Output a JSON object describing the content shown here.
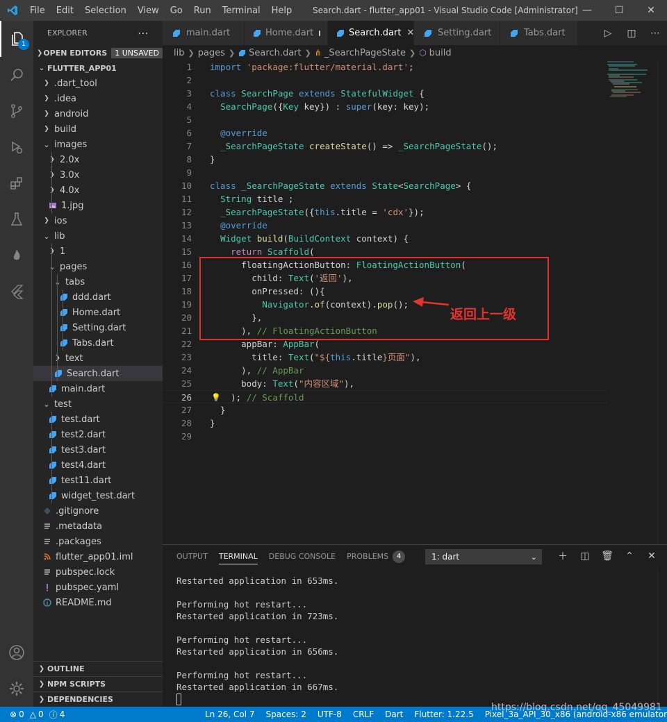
{
  "titlebar": {
    "menu": [
      "File",
      "Edit",
      "Selection",
      "View",
      "Go",
      "Run",
      "Terminal",
      "Help"
    ],
    "window_title": "Search.dart - flutter_app01 - Visual Studio Code [Administrator]"
  },
  "activity": {
    "explorer_badge": "1"
  },
  "sidebar": {
    "title": "EXPLORER",
    "open_editors": "OPEN EDITORS",
    "unsaved": "1 UNSAVED",
    "project": "FLUTTER_APP01",
    "tree": [
      {
        "label": ".dart_tool",
        "kind": "folder",
        "open": false,
        "depth": 1
      },
      {
        "label": ".idea",
        "kind": "folder",
        "open": false,
        "depth": 1
      },
      {
        "label": "android",
        "kind": "folder",
        "open": false,
        "depth": 1
      },
      {
        "label": "build",
        "kind": "folder",
        "open": false,
        "depth": 1
      },
      {
        "label": "images",
        "kind": "folder",
        "open": true,
        "depth": 1
      },
      {
        "label": "2.0x",
        "kind": "folder",
        "open": false,
        "depth": 2
      },
      {
        "label": "3.0x",
        "kind": "folder",
        "open": false,
        "depth": 2
      },
      {
        "label": "4.0x",
        "kind": "folder",
        "open": false,
        "depth": 2
      },
      {
        "label": "1.jpg",
        "kind": "image",
        "depth": 2
      },
      {
        "label": "ios",
        "kind": "folder",
        "open": false,
        "depth": 1
      },
      {
        "label": "lib",
        "kind": "folder",
        "open": true,
        "depth": 1
      },
      {
        "label": "1",
        "kind": "folder",
        "open": false,
        "depth": 2
      },
      {
        "label": "pages",
        "kind": "folder",
        "open": true,
        "depth": 2
      },
      {
        "label": "tabs",
        "kind": "folder",
        "open": true,
        "depth": 3
      },
      {
        "label": "ddd.dart",
        "kind": "dart",
        "depth": 4
      },
      {
        "label": "Home.dart",
        "kind": "dart",
        "depth": 4
      },
      {
        "label": "Setting.dart",
        "kind": "dart",
        "depth": 4
      },
      {
        "label": "Tabs.dart",
        "kind": "dart",
        "depth": 4
      },
      {
        "label": "text",
        "kind": "folder",
        "open": false,
        "depth": 3
      },
      {
        "label": "Search.dart",
        "kind": "dart",
        "depth": 3,
        "selected": true
      },
      {
        "label": "main.dart",
        "kind": "dart",
        "depth": 2
      },
      {
        "label": "test",
        "kind": "folder",
        "open": true,
        "depth": 1
      },
      {
        "label": "test.dart",
        "kind": "dart",
        "depth": 2
      },
      {
        "label": "test2.dart",
        "kind": "dart",
        "depth": 2
      },
      {
        "label": "test3.dart",
        "kind": "dart",
        "depth": 2
      },
      {
        "label": "test4.dart",
        "kind": "dart",
        "depth": 2
      },
      {
        "label": "test11.dart",
        "kind": "dart",
        "depth": 2
      },
      {
        "label": "widget_test.dart",
        "kind": "dart",
        "depth": 2
      },
      {
        "label": ".gitignore",
        "kind": "git",
        "depth": 1
      },
      {
        "label": ".metadata",
        "kind": "lines",
        "depth": 1
      },
      {
        "label": ".packages",
        "kind": "lines",
        "depth": 1
      },
      {
        "label": "flutter_app01.iml",
        "kind": "rss",
        "depth": 1
      },
      {
        "label": "pubspec.lock",
        "kind": "lines",
        "depth": 1
      },
      {
        "label": "pubspec.yaml",
        "kind": "yaml",
        "depth": 1
      },
      {
        "label": "README.md",
        "kind": "info",
        "depth": 1
      }
    ],
    "bottom_sections": [
      "OUTLINE",
      "NPM SCRIPTS",
      "DEPENDENCIES"
    ]
  },
  "tabs": [
    {
      "label": "main.dart",
      "state": "normal"
    },
    {
      "label": "Home.dart",
      "state": "dirty"
    },
    {
      "label": "Search.dart",
      "state": "active"
    },
    {
      "label": "Setting.dart",
      "state": "normal"
    },
    {
      "label": "Tabs.dart",
      "state": "normal"
    }
  ],
  "breadcrumb": [
    "lib",
    "pages",
    "Search.dart",
    "_SearchPageState",
    "build"
  ],
  "code": [
    {
      "n": "1",
      "t": [
        [
          "kw",
          "import"
        ],
        [
          "pl",
          " "
        ],
        [
          "str",
          "'package:flutter/material.dart'"
        ],
        [
          "pl",
          ";"
        ]
      ]
    },
    {
      "n": "2",
      "t": []
    },
    {
      "n": "3",
      "t": [
        [
          "kw",
          "class"
        ],
        [
          "pl",
          " "
        ],
        [
          "cls",
          "SearchPage"
        ],
        [
          "pl",
          " "
        ],
        [
          "kw",
          "extends"
        ],
        [
          "pl",
          " "
        ],
        [
          "cls",
          "StatefulWidget"
        ],
        [
          "pl",
          " {"
        ]
      ]
    },
    {
      "n": "4",
      "t": [
        [
          "pl",
          "  "
        ],
        [
          "cls",
          "SearchPage"
        ],
        [
          "pl",
          "({"
        ],
        [
          "cls",
          "Key"
        ],
        [
          "pl",
          " key}) : "
        ],
        [
          "kw",
          "super"
        ],
        [
          "pl",
          "(key: key);"
        ]
      ]
    },
    {
      "n": "5",
      "t": []
    },
    {
      "n": "6",
      "t": [
        [
          "pl",
          "  "
        ],
        [
          "kw",
          "@override"
        ]
      ]
    },
    {
      "n": "7",
      "t": [
        [
          "pl",
          "  "
        ],
        [
          "cls",
          "_SearchPageState"
        ],
        [
          "pl",
          " "
        ],
        [
          "fn",
          "createState"
        ],
        [
          "pl",
          "() => "
        ],
        [
          "cls",
          "_SearchPageState"
        ],
        [
          "pl",
          "();"
        ]
      ]
    },
    {
      "n": "8",
      "t": [
        [
          "pl",
          "}"
        ]
      ]
    },
    {
      "n": "9",
      "t": []
    },
    {
      "n": "10",
      "t": [
        [
          "kw",
          "class"
        ],
        [
          "pl",
          " "
        ],
        [
          "cls",
          "_SearchPageState"
        ],
        [
          "pl",
          " "
        ],
        [
          "kw",
          "extends"
        ],
        [
          "pl",
          " "
        ],
        [
          "cls",
          "State"
        ],
        [
          "pl",
          "<"
        ],
        [
          "cls",
          "SearchPage"
        ],
        [
          "pl",
          "> {"
        ]
      ]
    },
    {
      "n": "11",
      "t": [
        [
          "pl",
          "  "
        ],
        [
          "cls",
          "String"
        ],
        [
          "pl",
          " title ;"
        ]
      ]
    },
    {
      "n": "12",
      "t": [
        [
          "pl",
          "  "
        ],
        [
          "cls",
          "_SearchPageState"
        ],
        [
          "pl",
          "({"
        ],
        [
          "kw",
          "this"
        ],
        [
          "pl",
          ".title = "
        ],
        [
          "str",
          "'cdx'"
        ],
        [
          "pl",
          "});"
        ]
      ]
    },
    {
      "n": "13",
      "t": [
        [
          "pl",
          "  "
        ],
        [
          "kw",
          "@override"
        ]
      ]
    },
    {
      "n": "14",
      "t": [
        [
          "pl",
          "  "
        ],
        [
          "cls",
          "Widget"
        ],
        [
          "pl",
          " "
        ],
        [
          "fn",
          "build"
        ],
        [
          "pl",
          "("
        ],
        [
          "cls",
          "BuildContext"
        ],
        [
          "pl",
          " context) {"
        ]
      ]
    },
    {
      "n": "15",
      "t": [
        [
          "pl",
          "    "
        ],
        [
          "ctl",
          "return"
        ],
        [
          "pl",
          " "
        ],
        [
          "cls",
          "Scaffold"
        ],
        [
          "pl",
          "("
        ]
      ]
    },
    {
      "n": "16",
      "t": [
        [
          "pl",
          "      floatingActionButton: "
        ],
        [
          "cls",
          "FloatingActionButton"
        ],
        [
          "pl",
          "("
        ]
      ]
    },
    {
      "n": "17",
      "t": [
        [
          "pl",
          "        child: "
        ],
        [
          "cls",
          "Text"
        ],
        [
          "pl",
          "("
        ],
        [
          "str",
          "'返回'"
        ],
        [
          "pl",
          "),"
        ]
      ]
    },
    {
      "n": "18",
      "t": [
        [
          "pl",
          "        onPressed: (){"
        ]
      ]
    },
    {
      "n": "19",
      "t": [
        [
          "pl",
          "          "
        ],
        [
          "cls",
          "Navigator"
        ],
        [
          "pl",
          "."
        ],
        [
          "fn",
          "of"
        ],
        [
          "pl",
          "(context)."
        ],
        [
          "fn",
          "pop"
        ],
        [
          "pl",
          "();"
        ]
      ]
    },
    {
      "n": "20",
      "t": [
        [
          "pl",
          "        },"
        ]
      ]
    },
    {
      "n": "21",
      "t": [
        [
          "pl",
          "      ), "
        ],
        [
          "cmt",
          "// FloatingActionButton"
        ]
      ]
    },
    {
      "n": "22",
      "t": [
        [
          "pl",
          "      appBar: "
        ],
        [
          "cls",
          "AppBar"
        ],
        [
          "pl",
          "("
        ]
      ]
    },
    {
      "n": "23",
      "t": [
        [
          "pl",
          "        title: "
        ],
        [
          "cls",
          "Text"
        ],
        [
          "pl",
          "("
        ],
        [
          "str",
          "\"${"
        ],
        [
          "kw",
          "this"
        ],
        [
          "pl",
          ".title"
        ],
        [
          "str",
          "}页面\""
        ],
        [
          "pl",
          "),"
        ]
      ]
    },
    {
      "n": "24",
      "t": [
        [
          "pl",
          "      ), "
        ],
        [
          "cmt",
          "// AppBar"
        ]
      ]
    },
    {
      "n": "25",
      "t": [
        [
          "pl",
          "      body: "
        ],
        [
          "cls",
          "Text"
        ],
        [
          "pl",
          "("
        ],
        [
          "str",
          "\"内容区域\""
        ],
        [
          "pl",
          "),"
        ]
      ]
    },
    {
      "n": "26",
      "t": [
        [
          "pl",
          "    ); "
        ],
        [
          "cmt",
          "// Scaffold"
        ]
      ]
    },
    {
      "n": "27",
      "t": [
        [
          "pl",
          "  }"
        ]
      ]
    },
    {
      "n": "28",
      "t": [
        [
          "pl",
          "}"
        ]
      ]
    },
    {
      "n": "29",
      "t": []
    }
  ],
  "annotation": {
    "text": "返回上一级"
  },
  "panel": {
    "tabs": [
      "OUTPUT",
      "TERMINAL",
      "DEBUG CONSOLE",
      "PROBLEMS"
    ],
    "problems_count": "4",
    "terminal_select": "1: dart",
    "lines": [
      "Restarted application in 653ms.",
      "",
      "Performing hot restart...",
      "Restarted application in 723ms.",
      "",
      "Performing hot restart...",
      "Restarted application in 656ms.",
      "",
      "Performing hot restart...",
      "Restarted application in 667ms."
    ]
  },
  "statusbar": {
    "errors": "0",
    "warnings": "0",
    "info": "4",
    "position": "Ln 26, Col 7",
    "spaces": "Spaces: 2",
    "encoding": "UTF-8",
    "eol": "CRLF",
    "language": "Dart",
    "flutter": "Flutter: 1.22.5",
    "device": "Pixel_3a_API_30_x86 (android-x86 emulator)"
  },
  "watermark": "https://blog.csdn.net/qq_45049981"
}
